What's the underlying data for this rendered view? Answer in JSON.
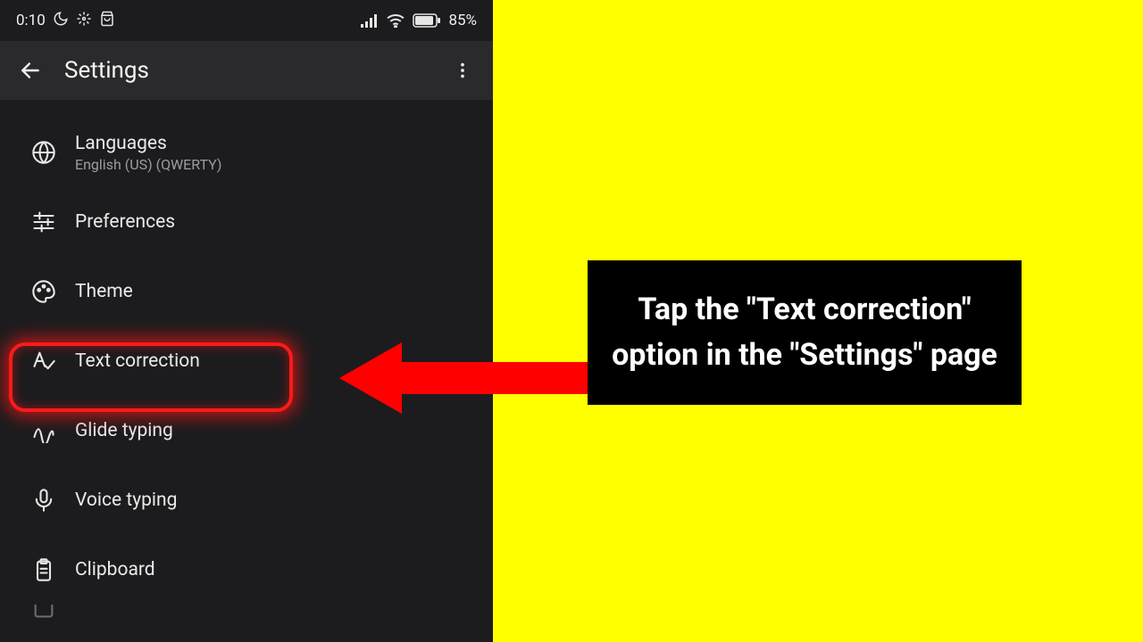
{
  "status": {
    "time": "0:10",
    "battery_text": "85%"
  },
  "appbar": {
    "title": "Settings"
  },
  "settings": {
    "languages": {
      "title": "Languages",
      "sub": "English (US) (QWERTY)"
    },
    "preferences": {
      "title": "Preferences"
    },
    "theme": {
      "title": "Theme"
    },
    "text_correction": {
      "title": "Text correction"
    },
    "glide": {
      "title": "Glide typing"
    },
    "voice": {
      "title": "Voice typing"
    },
    "clipboard": {
      "title": "Clipboard"
    }
  },
  "instruction": "Tap the \"Text correction\" option in the \"Settings\" page"
}
